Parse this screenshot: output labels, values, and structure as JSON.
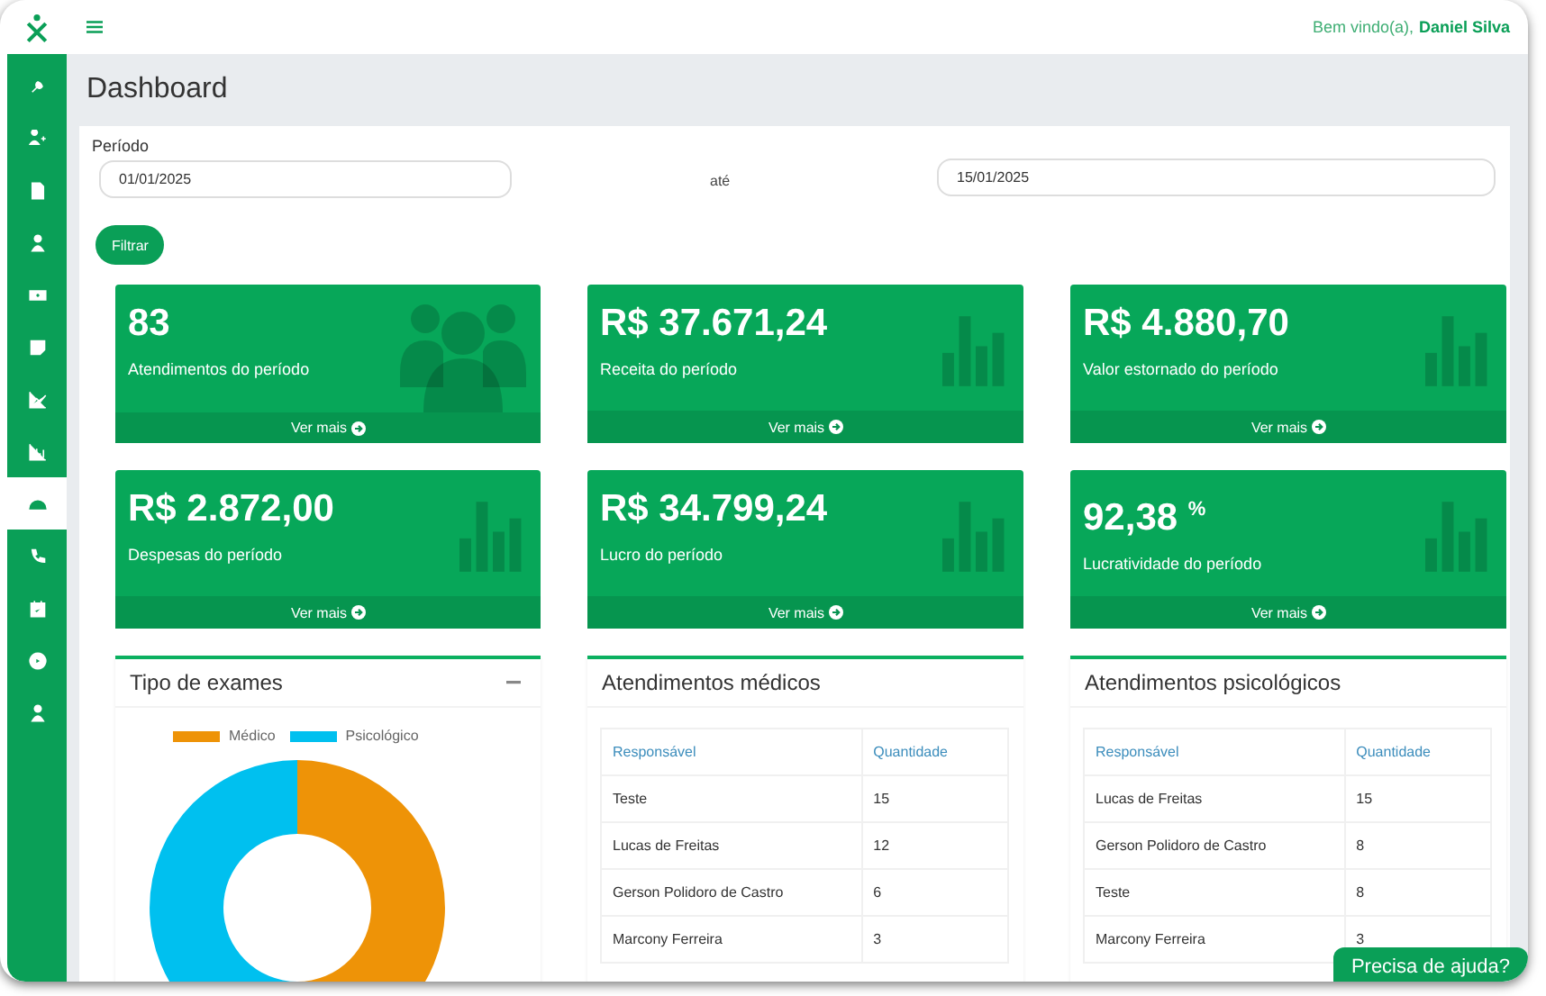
{
  "topbar": {
    "greeting": "Bem vindo(a),",
    "user": "Daniel Silva"
  },
  "sidebar": {
    "items": [
      {
        "selected": false
      },
      {
        "selected": false
      },
      {
        "selected": false
      },
      {
        "selected": false
      },
      {
        "selected": false
      },
      {
        "selected": false
      },
      {
        "selected": false
      },
      {
        "selected": false
      },
      {
        "selected": true
      },
      {
        "selected": false
      },
      {
        "selected": false
      },
      {
        "selected": false
      },
      {
        "selected": false
      }
    ]
  },
  "page_title": "Dashboard",
  "filter": {
    "label": "Período",
    "start": "01/01/2025",
    "separator": "até",
    "end": "15/01/2025",
    "button": "Filtrar"
  },
  "stats": [
    {
      "value": "83",
      "label": "Atendimentos do período",
      "link": "Ver mais",
      "kind": "people"
    },
    {
      "value": "R$ 37.671,24",
      "label": "Receita do período",
      "link": "Ver mais",
      "kind": "bars"
    },
    {
      "value": "R$ 4.880,70",
      "label": "Valor estornado do período",
      "link": "Ver mais",
      "kind": "bars"
    },
    {
      "value": "R$ 2.872,00",
      "label": "Despesas do período",
      "link": "Ver mais",
      "kind": "bars"
    },
    {
      "value": "R$ 34.799,24",
      "label": "Lucro do período",
      "link": "Ver mais",
      "kind": "bars"
    },
    {
      "value": "92,38 $^{%}$",
      "label": "Lucratividade do período",
      "link": "Ver mais",
      "kind": "bars"
    }
  ],
  "exam_types": {
    "title": "Tipo de exames",
    "legend": [
      {
        "label": "Médico",
        "color": "#ee9307"
      },
      {
        "label": "Psicológico",
        "color": "#00c0ef"
      }
    ]
  },
  "tables": [
    {
      "title": "Atendimentos médicos",
      "columns": [
        "Responsável",
        "Quantidade"
      ],
      "rows": [
        [
          "Teste",
          "15"
        ],
        [
          "Lucas de Freitas",
          "12"
        ],
        [
          "Gerson Polidoro de Castro",
          "6"
        ],
        [
          "Marcony Ferreira",
          "3"
        ]
      ]
    },
    {
      "title": "Atendimentos psicológicos",
      "columns": [
        "Responsável",
        "Quantidade"
      ],
      "rows": [
        [
          "Lucas de Freitas",
          "15"
        ],
        [
          "Gerson Polidoro de Castro",
          "8"
        ],
        [
          "Teste",
          "8"
        ],
        [
          "Marcony Ferreira",
          "3"
        ]
      ]
    }
  ],
  "help_button": "Precisa de ajuda?"
}
